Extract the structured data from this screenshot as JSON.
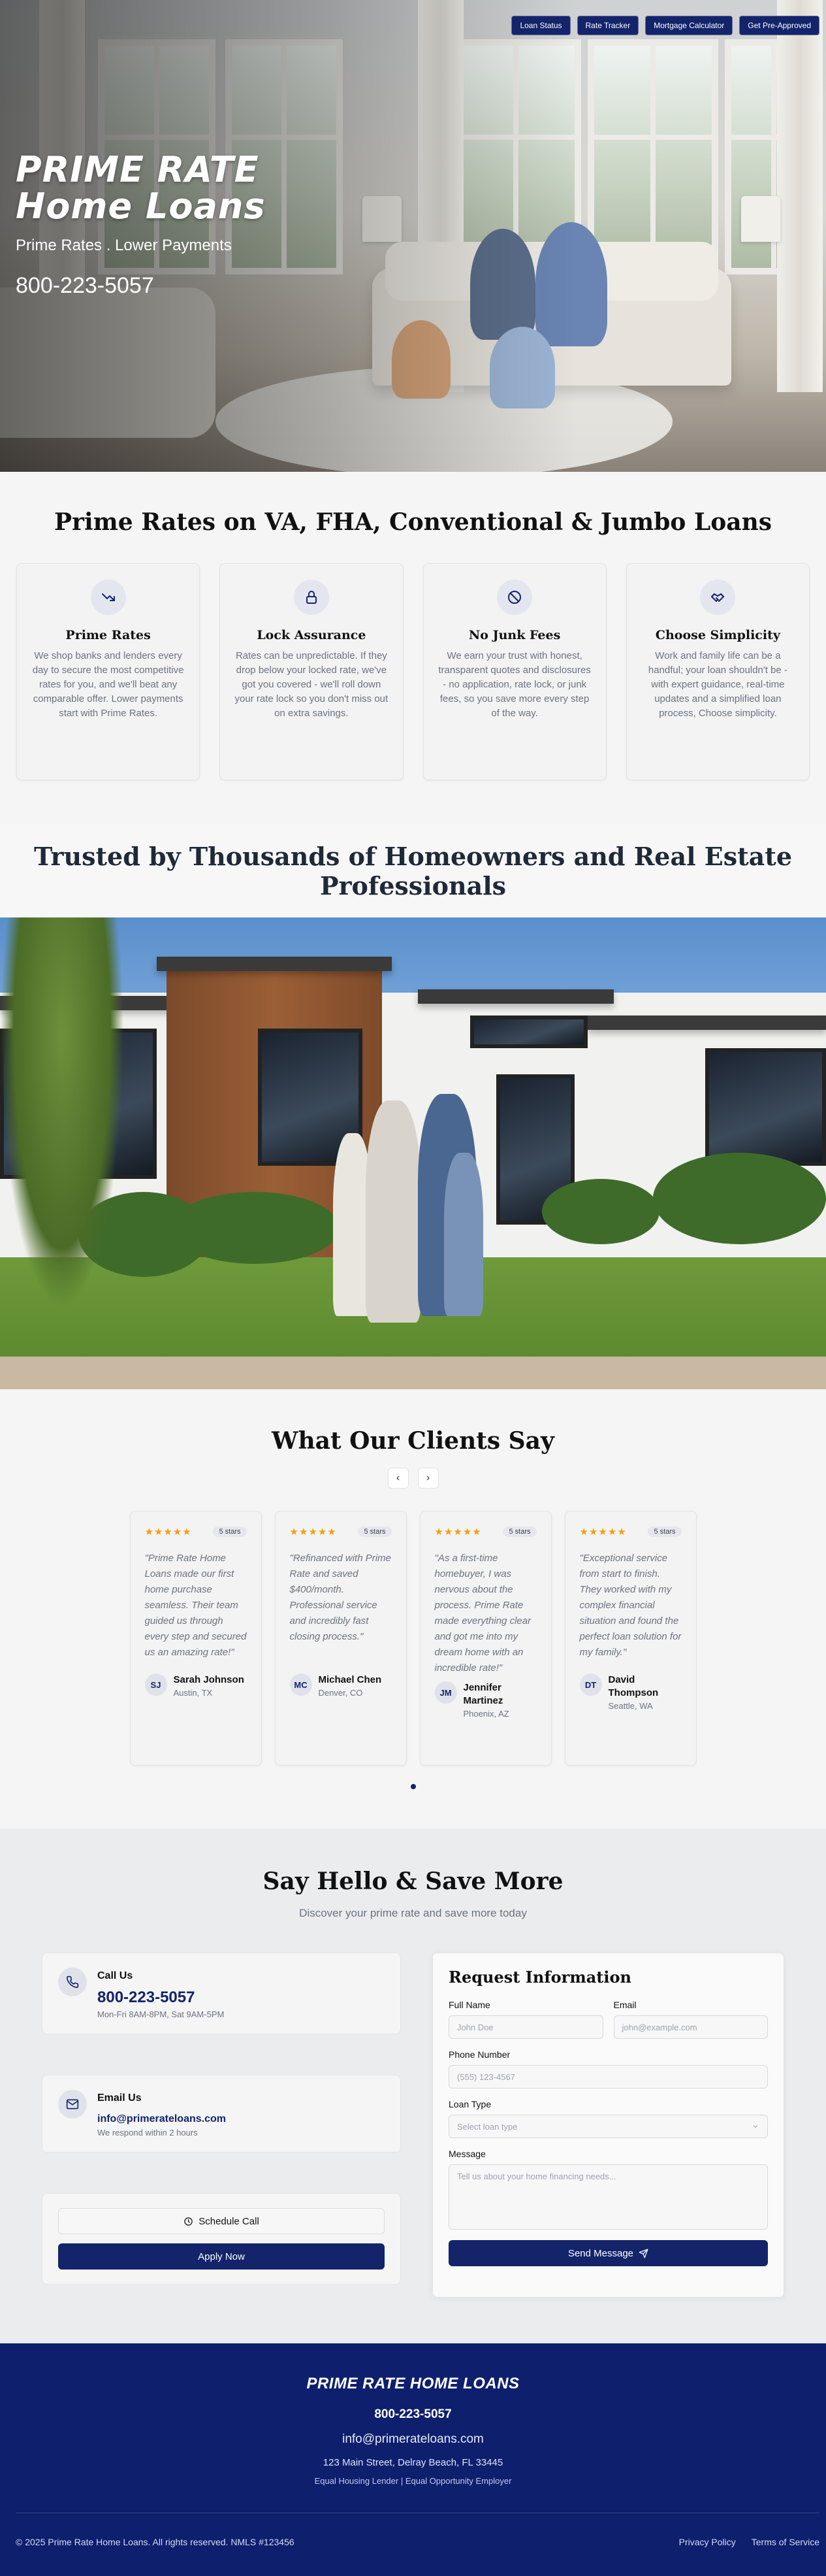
{
  "nav": {
    "items": [
      "Loan Status",
      "Rate Tracker",
      "Mortgage Calculator",
      "Get Pre-Approved"
    ]
  },
  "hero": {
    "title_line1": "PRIME RATE",
    "title_line2": "Home Loans",
    "tagline": "Prime Rates . Lower Payments",
    "phone": "800-223-5057"
  },
  "features": {
    "title": "Prime Rates on VA, FHA, Conventional & Jumbo Loans",
    "cards": [
      {
        "icon": "trending-down-icon",
        "title": "Prime Rates",
        "text": "We shop banks and lenders every day to secure the most competitive rates for you, and we'll beat any comparable offer. Lower payments start with Prime Rates."
      },
      {
        "icon": "lock-icon",
        "title": "Lock Assurance",
        "text": "Rates can be unpredictable. If they drop below your locked rate, we've got you covered - we'll roll down your rate lock so you don't miss out on extra savings."
      },
      {
        "icon": "ban-icon",
        "title": "No Junk Fees",
        "text": "We earn your trust with honest, transparent quotes and disclosures - no application, rate lock, or junk fees, so you save more every step of the way."
      },
      {
        "icon": "handshake-icon",
        "title": "Choose Simplicity",
        "text": "Work and family life can be a handful; your loan shouldn't be - with expert guidance, real-time updates and a simplified loan process, Choose simplicity."
      }
    ]
  },
  "trusted": {
    "title": "Trusted by Thousands of Homeowners and Real Estate Professionals"
  },
  "testimonials": {
    "title": "What Our Clients Say",
    "prev": "‹",
    "next": "›",
    "stars": "★★★★★",
    "items": [
      {
        "badge": "5 stars",
        "quote": "\"Prime Rate Home Loans made our first home purchase seamless. Their team guided us through every step and secured us an amazing rate!\"",
        "initials": "SJ",
        "name": "Sarah Johnson",
        "location": "Austin, TX"
      },
      {
        "badge": "5 stars",
        "quote": "\"Refinanced with Prime Rate and saved $400/month. Professional service and incredibly fast closing process.\"",
        "initials": "MC",
        "name": "Michael Chen",
        "location": "Denver, CO"
      },
      {
        "badge": "5 stars",
        "quote": "\"As a first-time homebuyer, I was nervous about the process. Prime Rate made everything clear and got me into my dream home with an incredible rate!\"",
        "initials": "JM",
        "name": "Jennifer Martinez",
        "location": "Phoenix, AZ"
      },
      {
        "badge": "5 stars",
        "quote": "\"Exceptional service from start to finish. They worked with my complex financial situation and found the perfect loan solution for my family.\"",
        "initials": "DT",
        "name": "David Thompson",
        "location": "Seattle, WA"
      }
    ]
  },
  "contact": {
    "title": "Say Hello & Save More",
    "subtitle": "Discover your prime rate and save more today",
    "call": {
      "label": "Call Us",
      "phone": "800-223-5057",
      "hours": "Mon-Fri 8AM-8PM, Sat 9AM-5PM"
    },
    "email": {
      "label": "Email Us",
      "address": "info@primerateloans.com",
      "note": "We respond within 2 hours"
    },
    "schedule_label": "Schedule Call",
    "apply_label": "Apply Now",
    "form": {
      "title": "Request Information",
      "full_name_label": "Full Name",
      "full_name_placeholder": "John Doe",
      "email_label": "Email",
      "email_placeholder": "john@example.com",
      "phone_label": "Phone Number",
      "phone_placeholder": "(555) 123-4567",
      "loan_type_label": "Loan Type",
      "loan_type_placeholder": "Select loan type",
      "message_label": "Message",
      "message_placeholder": "Tell us about your home financing needs...",
      "submit_label": "Send Message"
    }
  },
  "footer": {
    "brand": "PRIME RATE HOME LOANS",
    "phone": "800-223-5057",
    "email": "info@primerateloans.com",
    "address": "123 Main Street, Delray Beach, FL 33445",
    "equal": "Equal Housing Lender | Equal Opportunity Employer",
    "copyright": "© 2025 Prime Rate Home Loans. All rights reserved. NMLS #123456",
    "privacy": "Privacy Policy",
    "terms": "Terms of Service"
  },
  "colors": {
    "brand": "#13246b",
    "footer": "#0d1f6d",
    "star": "#f59e0b"
  }
}
